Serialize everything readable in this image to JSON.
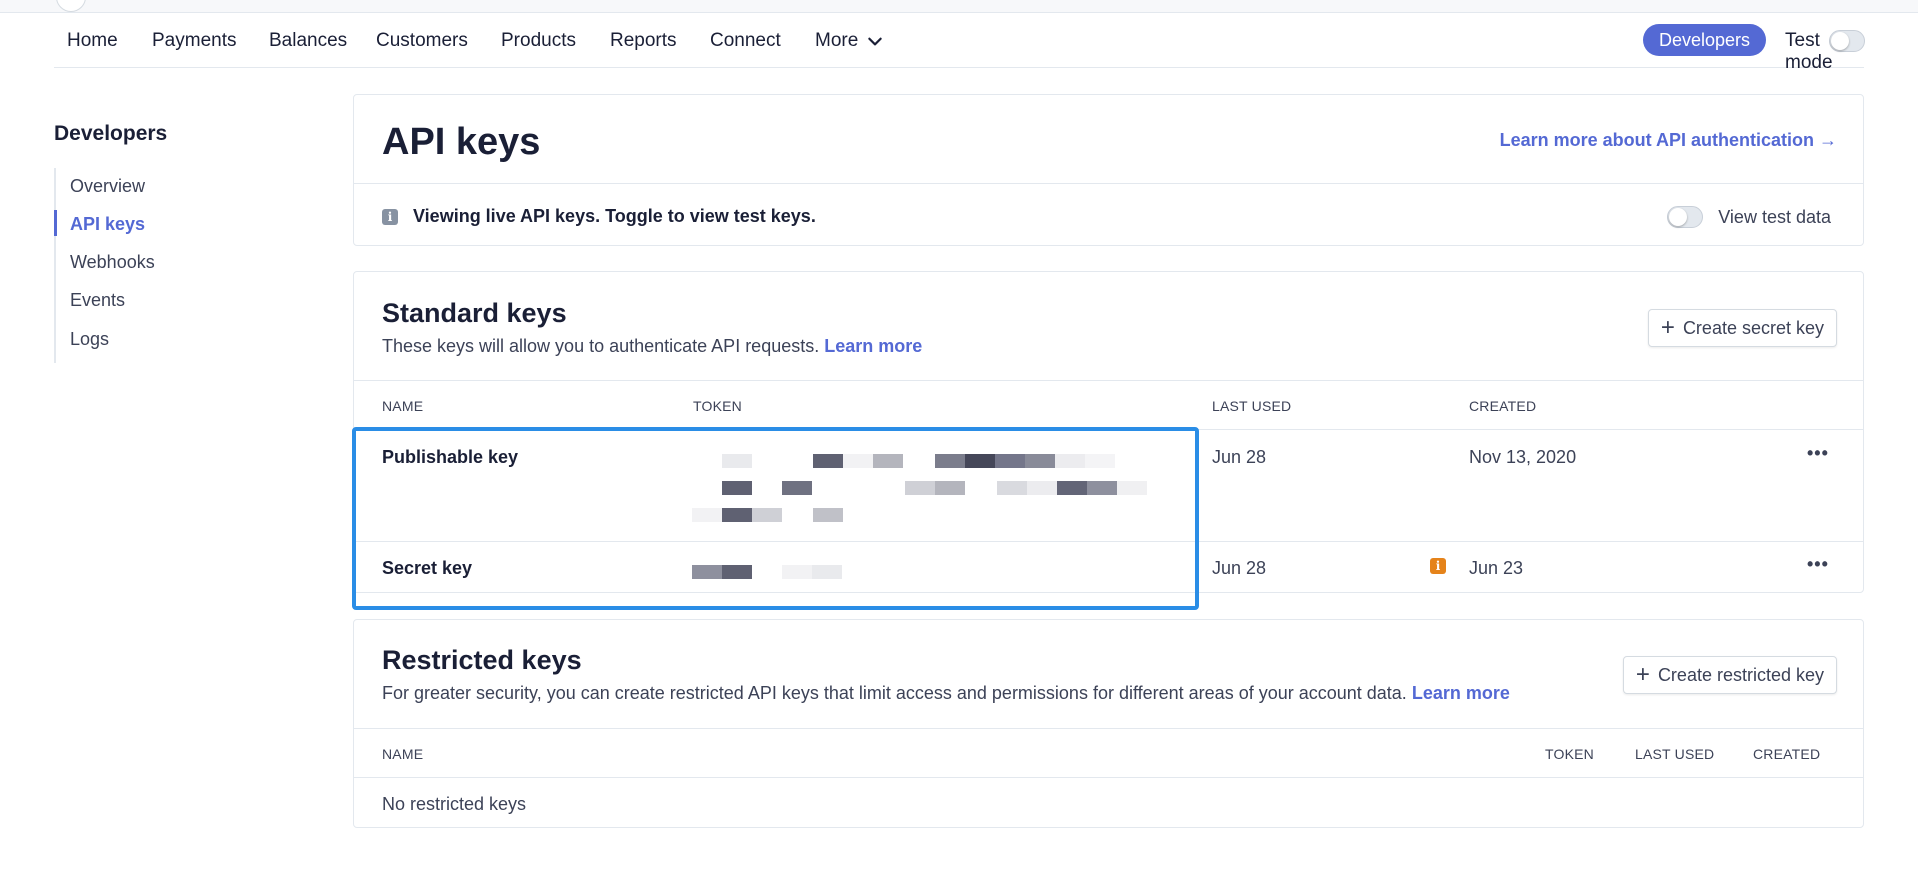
{
  "nav": {
    "items": [
      "Home",
      "Payments",
      "Balances",
      "Customers",
      "Products",
      "Reports",
      "Connect"
    ],
    "more_label": "More",
    "developers_label": "Developers",
    "test_mode_label": "Test mode"
  },
  "sidebar": {
    "title": "Developers",
    "items": [
      "Overview",
      "API keys",
      "Webhooks",
      "Events",
      "Logs"
    ],
    "active_item": "API keys"
  },
  "header": {
    "title": "API keys",
    "learn_link": "Learn more about API authentication →",
    "notice": "Viewing live API keys. Toggle to view test keys.",
    "view_test_label": "View test data"
  },
  "standard_keys": {
    "title": "Standard keys",
    "description": "These keys will allow you to authenticate API requests.",
    "learn_more": "Learn more",
    "create_button": "Create secret key",
    "columns": [
      "NAME",
      "TOKEN",
      "LAST USED",
      "CREATED"
    ],
    "rows": [
      {
        "name": "Publishable key",
        "last_used": "Jun 28",
        "created": "Nov 13, 2020"
      },
      {
        "name": "Secret key",
        "last_used": "Jun 28",
        "created": "Jun 23"
      }
    ]
  },
  "restricted_keys": {
    "title": "Restricted keys",
    "description": "For greater security, you can create restricted API keys that limit access and permissions for different areas of your account data.",
    "learn_more": "Learn more",
    "create_button": "Create restricted key",
    "columns": [
      "NAME",
      "TOKEN",
      "LAST USED",
      "CREATED"
    ],
    "empty_text": "No restricted keys"
  },
  "colors": {
    "accent": "#5469d4",
    "highlight_border": "#2a8de6",
    "warning_icon": "#e5831a"
  }
}
